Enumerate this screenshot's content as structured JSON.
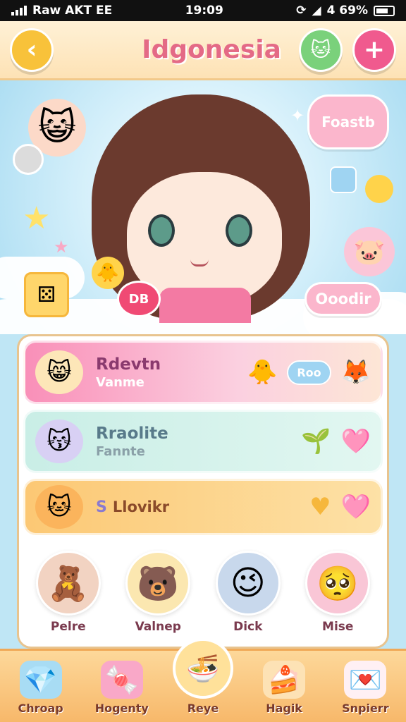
{
  "status_bar": {
    "carrier": "Raw AKT EE",
    "time": "19:09",
    "battery": "4 69%"
  },
  "header": {
    "title": "Idgonesia"
  },
  "hero": {
    "bubble_top": "Foastb",
    "bubble_bottom": "Ooodir",
    "apple_tag": "DB"
  },
  "rows": [
    {
      "name": "Rdevtn",
      "sub": "Vanme",
      "tag": "Roo"
    },
    {
      "name": "Rraolite",
      "sub": "Fannte"
    },
    {
      "name": "Llovikr",
      "prefix": "S"
    }
  ],
  "friends": [
    {
      "name": "Pelre"
    },
    {
      "name": "Valnep"
    },
    {
      "name": "Dick"
    },
    {
      "name": "Mise"
    }
  ],
  "nav": [
    {
      "label": "Chroap",
      "icon": "diamond-icon"
    },
    {
      "label": "Hogenty",
      "icon": "slime-icon"
    },
    {
      "label": "Reye",
      "icon": "bowl-icon"
    },
    {
      "label": "Hagik",
      "icon": "cake-icon"
    },
    {
      "label": "Snpierr",
      "icon": "card-icon"
    }
  ]
}
